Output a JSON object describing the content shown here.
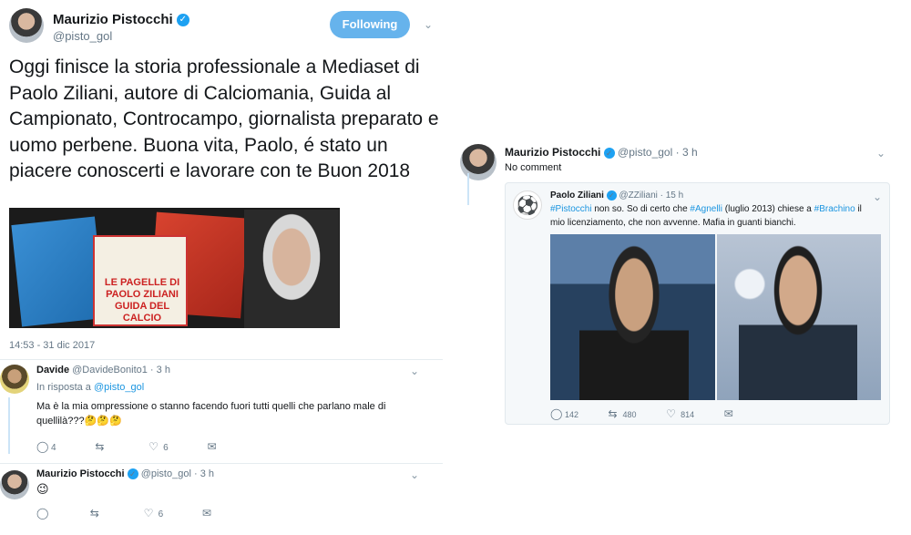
{
  "main_tweet": {
    "author_name": "Maurizio Pistocchi",
    "handle": "@pisto_gol",
    "follow_label": "Following",
    "text": "Oggi finisce la storia professionale a Mediaset di Paolo Ziliani, autore di Calciomania, Guida al Campionato, Controcampo, giornalista preparato e uomo perbene. Buona vita, Paolo, é stato un piacere conoscerti e lavorare con te Buon 2018",
    "photo_book_title": "LE PAGELLE DI PAOLO ZILIANI GUIDA DEL CALCIO",
    "timestamp": "14:53 - 31 dic 2017"
  },
  "reply1": {
    "name": "Davide",
    "handle": "@DavideBonito1",
    "time": "· 3 h",
    "in_reply_prefix": "In risposta a ",
    "in_reply_handle": "@pisto_gol",
    "text": "Ma è la mia ompressione o stanno facendo fuori tutti quelli che parlano male di quellilà???🤔🤔🤔",
    "replies": "4",
    "retweets": "",
    "likes": "6"
  },
  "reply2": {
    "name": "Maurizio Pistocchi",
    "handle": "@pisto_gol",
    "time": "· 3 h",
    "text": "😉",
    "replies": "",
    "retweets": "",
    "likes": "6"
  },
  "right_tweet": {
    "name": "Maurizio Pistocchi",
    "handle": "@pisto_gol",
    "time": "· 3 h",
    "text": "No comment",
    "quoted": {
      "name": "Paolo Ziliani",
      "handle": "@ZZiliani",
      "time": "· 15 h",
      "text": "#Pistocchi non so. So di certo che #Agnelli (luglio 2013) chiese a #Brachino il mio licenziamento, che non avvenne. Mafia in guanti bianchi.",
      "replies": "142",
      "retweets": "480",
      "likes": "814"
    }
  },
  "icons": {
    "reply": "reply-icon",
    "retweet": "retweet-icon",
    "like": "heart-icon",
    "dm": "envelope-icon",
    "verified": "verified-badge-icon",
    "chevron": "chevron-down-icon"
  },
  "colors": {
    "accent": "#1da1f2",
    "follow_button": "#66b3ec",
    "muted": "#657786",
    "thread_line": "#cce4f7"
  }
}
